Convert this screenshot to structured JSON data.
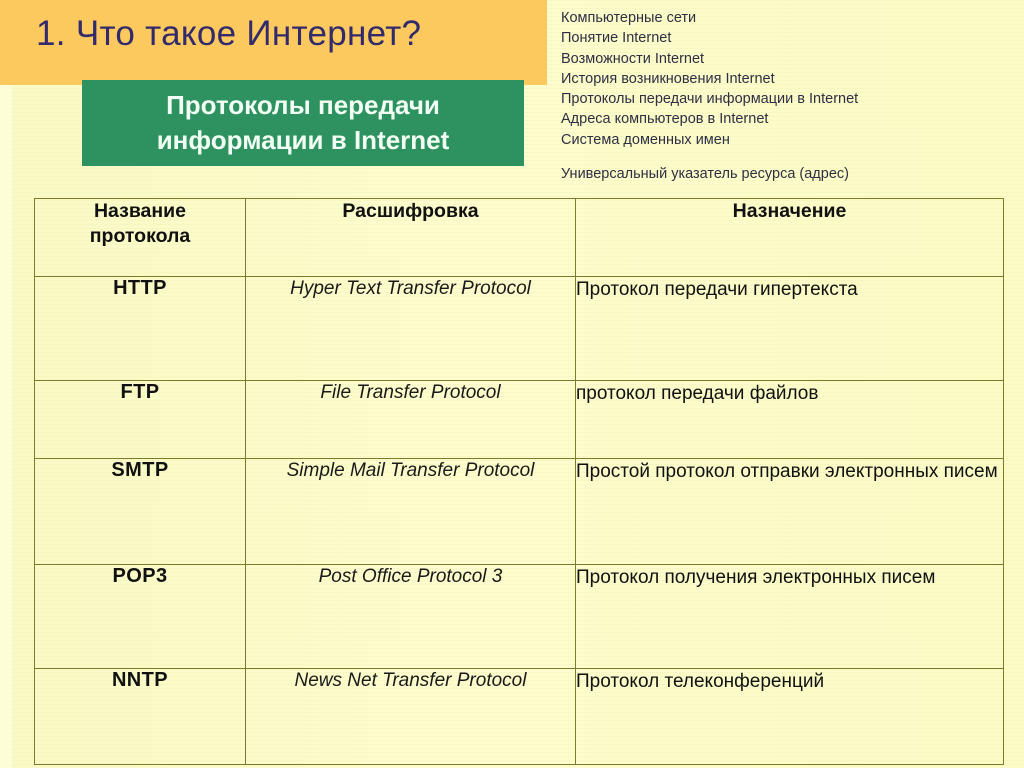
{
  "slide": {
    "title": "1. Что такое Интернет?",
    "banner": {
      "line1": "Протоколы передачи",
      "line2": "информации в  Internet"
    },
    "colors": {
      "title_band": "#fcc95e",
      "title_text": "#332a6b",
      "banner_bg": "#2d9160",
      "banner_text": "#f2fff4",
      "page_bg": "#fbfbc8",
      "table_border": "#7d7a2a"
    }
  },
  "topics": [
    "Компьютерные сети",
    "Понятие Internet",
    "Возможности Internet",
    "История возникновения Internet",
    "Протоколы передачи информации  в Internet",
    "Адреса компьютеров в Internet",
    "Система доменных имен",
    "Универсальный указатель ресурса (адрес)"
  ],
  "table": {
    "headers": [
      "Название\nпротокола",
      "Расшифровка",
      "Назначение"
    ],
    "headers_split": {
      "col1_line1": "Название",
      "col1_line2": "протокола",
      "col2": "Расшифровка",
      "col3": "Назначение"
    },
    "rows": [
      {
        "name": "HTTP",
        "expansion": "Hyper Text Transfer Protocol",
        "purpose": "Протокол передачи гипертекста"
      },
      {
        "name": "FTP",
        "expansion": "File Transfer Protocol",
        "purpose": "протокол передачи файлов"
      },
      {
        "name": "SMTP",
        "expansion": "Simple Mail Transfer Protocol",
        "purpose": "Простой протокол отправки электронных писем"
      },
      {
        "name": "POP3",
        "expansion": "Post Office Protocol 3",
        "purpose": "Протокол получения электронных писем"
      },
      {
        "name": "NNTP",
        "expansion": "News Net Transfer Protocol",
        "purpose": "Протокол телеконференций"
      }
    ]
  }
}
